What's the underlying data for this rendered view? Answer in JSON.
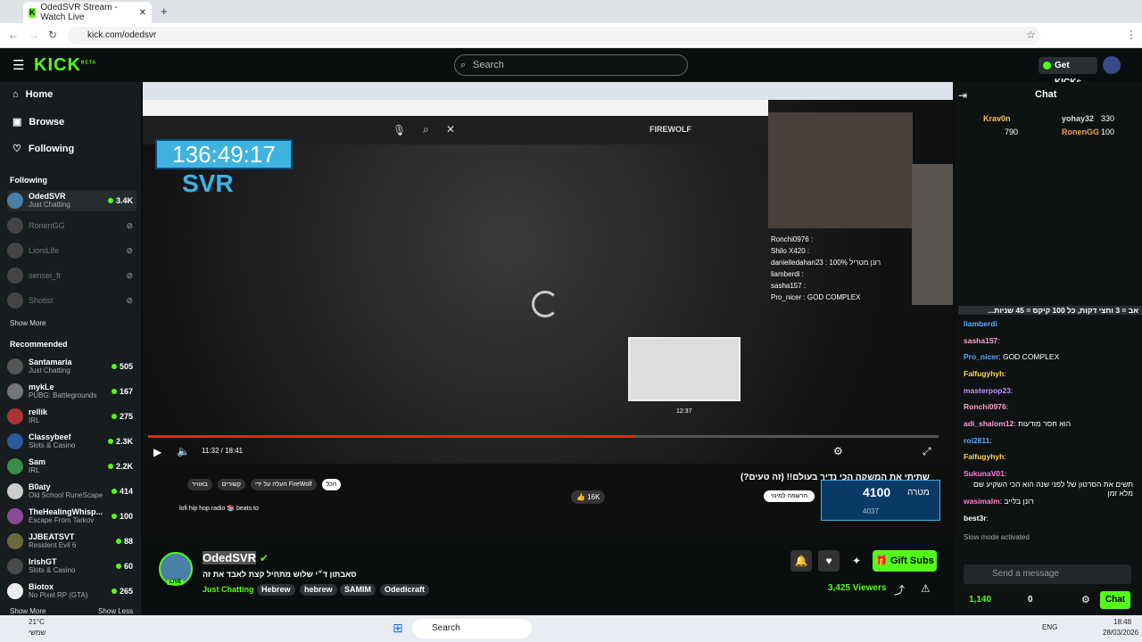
{
  "browser": {
    "tab_title": "OdedSVR Stream - Watch Live",
    "url": "kick.com/odedsvr"
  },
  "header": {
    "logo": "KICK",
    "beta": "BETA",
    "search_placeholder": "Search",
    "get_kicks": "Get KICKs"
  },
  "nav": [
    {
      "label": "Home",
      "icon": "home-icon"
    },
    {
      "label": "Browse",
      "icon": "browse-icon"
    },
    {
      "label": "Following",
      "icon": "heart-icon"
    }
  ],
  "following": {
    "title": "Following",
    "channels": [
      {
        "name": "OdedSVR",
        "category": "Just Chatting",
        "viewers": "3.4K",
        "live": true
      },
      {
        "name": "RonenGG",
        "live": false
      },
      {
        "name": "LiorsLife",
        "live": false
      },
      {
        "name": "sensei_fr",
        "live": false
      },
      {
        "name": "Shotist",
        "live": false
      }
    ],
    "show_more": "Show More"
  },
  "recommended": {
    "title": "Recommended",
    "channels": [
      {
        "name": "Santamaria",
        "category": "Just Chatting",
        "viewers": "505"
      },
      {
        "name": "mykLe",
        "category": "PUBG: Battlegrounds",
        "viewers": "167"
      },
      {
        "name": "rellik",
        "category": "IRL",
        "viewers": "275"
      },
      {
        "name": "Classybeef",
        "category": "Slots & Casino",
        "viewers": "2.3K"
      },
      {
        "name": "Sam",
        "category": "IRL",
        "viewers": "2.2K"
      },
      {
        "name": "B0aty",
        "category": "Old School RuneScape",
        "viewers": "414"
      },
      {
        "name": "TheHealingWhisp...",
        "category": "Escape From Tarkov",
        "viewers": "100"
      },
      {
        "name": "JJBEATSVT",
        "category": "Resident Evil 6",
        "viewers": "88"
      },
      {
        "name": "IrishGT",
        "category": "Slots & Casino",
        "viewers": "60"
      },
      {
        "name": "Biotox",
        "category": "No Pixel RP (GTA)",
        "viewers": "265"
      }
    ],
    "show_more": "Show More",
    "show_less": "Show Less"
  },
  "video": {
    "timer": "136:49:17",
    "svr": "SVR",
    "time": "11:32 / 18:41",
    "hover_time": "12:37",
    "firewolf": "FIREWOLF",
    "yt_title": "שתיתי את המשקה הכי נדיר בעולם!! (זה טעים?)",
    "likes": "16K",
    "goal_value": "4100",
    "goal_label": "מטרה",
    "goal_current": "4037",
    "lofi": "lofi hip hop radio 📚 beats to",
    "subscribe": "הרשמה למינוי",
    "sub_tabs": [
      "הכל",
      "העלה על ידי FireWolf",
      "קשורים",
      "באוויר"
    ],
    "chat_overlay": [
      "Ronchi0976 :",
      "Shilo X420 :",
      "danielledahan23 : רונן מטריל 100%",
      "liamberdi :",
      "sasha157 :",
      "Pro_nicer : GOD COMPLEX"
    ]
  },
  "streamer": {
    "name": "OdedSVR",
    "title": "סאבתון ד״י שלוש מתחיל קצת לאבד את זה",
    "category": "Just Chatting",
    "tags": [
      "Hebrew",
      "hebrew",
      "SAMIM",
      "Odedicraft"
    ],
    "viewers": "3,425 Viewers",
    "live": "LIVE",
    "gift": "Gift Subs"
  },
  "chat": {
    "title": "Chat",
    "leaders": [
      {
        "name": "Krav0n",
        "count": "790"
      },
      {
        "name": "yohay32",
        "count": "330"
      },
      {
        "name": "RonenGG",
        "count": "100"
      }
    ],
    "banner": "אב = 3 וחצי דקות, כל 100 קיקס = 45 שניות...",
    "messages": [
      {
        "user": "liamberdi",
        "text": ""
      },
      {
        "user": "sasha157",
        "text": ""
      },
      {
        "user": "Pro_nicer",
        "text": "GOD COMPLEX"
      },
      {
        "user": "Falfugyhyh",
        "text": ""
      },
      {
        "user": "masterpop23",
        "text": ""
      },
      {
        "user": "Ronchi0976",
        "text": ""
      },
      {
        "user": "adi_shalom12",
        "text": "הוא חסר מודעות"
      },
      {
        "user": "roi2811",
        "text": ""
      },
      {
        "user": "Falfugyhyh",
        "text": ""
      },
      {
        "user": "SukunaV01",
        "text": "תשים את הסרטון של לפני שנה הוא הכי השקיע שם מלא זמן"
      },
      {
        "user": "wasimalm",
        "text": "רונן בלייב"
      },
      {
        "user": "best3r",
        "text": ""
      }
    ],
    "slow_mode": "Slow mode activated",
    "placeholder": "Send a message",
    "points": "1,140",
    "kicks": "0",
    "send": "Chat"
  },
  "taskbar": {
    "temp": "21°C",
    "weather": "שמשי",
    "search": "Search",
    "lang": "ENG",
    "time": "18:48",
    "date": "28/03/2026"
  }
}
